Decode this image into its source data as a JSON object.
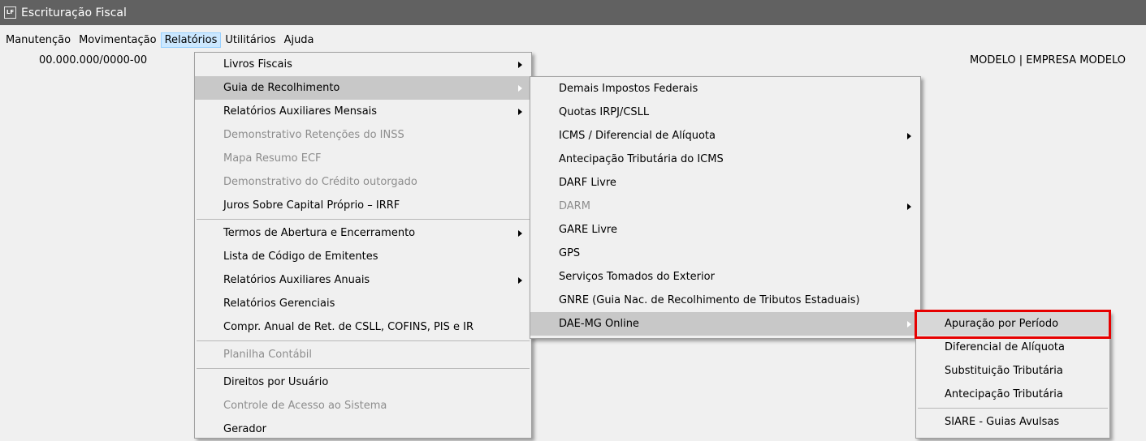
{
  "window": {
    "icon_text": "LF",
    "title": "Escrituração Fiscal"
  },
  "menubar": {
    "items": [
      "Manutenção",
      "Movimentação",
      "Relatórios",
      "Utilitários",
      "Ajuda"
    ],
    "active": "Relatórios"
  },
  "info": {
    "cnpj": "00.000.000/0000-00",
    "empresa": "MODELO | EMPRESA MODELO"
  },
  "relatorios_menu": {
    "items": [
      {
        "label": "Livros Fiscais",
        "submenu": true,
        "enabled": true
      },
      {
        "label": "Guia de Recolhimento",
        "submenu": true,
        "enabled": true,
        "highlighted": true
      },
      {
        "label": "Relatórios Auxiliares Mensais",
        "submenu": true,
        "enabled": true
      },
      {
        "label": "Demonstrativo Retenções do INSS",
        "submenu": false,
        "enabled": false
      },
      {
        "label": "Mapa Resumo ECF",
        "submenu": false,
        "enabled": false
      },
      {
        "label": "Demonstrativo do Crédito outorgado",
        "submenu": false,
        "enabled": false
      },
      {
        "label": "Juros Sobre Capital Próprio – IRRF",
        "submenu": false,
        "enabled": true
      },
      {
        "label": "Termos de Abertura e Encerramento",
        "submenu": true,
        "enabled": true
      },
      {
        "label": "Lista de Código de Emitentes",
        "submenu": false,
        "enabled": true
      },
      {
        "label": "Relatórios Auxiliares Anuais",
        "submenu": true,
        "enabled": true
      },
      {
        "label": "Relatórios Gerenciais",
        "submenu": false,
        "enabled": true
      },
      {
        "label": "Compr. Anual de Ret. de CSLL, COFINS,  PIS e IR",
        "submenu": false,
        "enabled": true
      },
      {
        "label": "Planilha Contábil",
        "submenu": false,
        "enabled": false
      },
      {
        "label": "Direitos por Usuário",
        "submenu": false,
        "enabled": true
      },
      {
        "label": "Controle de Acesso ao Sistema",
        "submenu": false,
        "enabled": false
      },
      {
        "label": "Gerador",
        "submenu": false,
        "enabled": true
      }
    ]
  },
  "guia_menu": {
    "items": [
      {
        "label": "Demais Impostos Federais",
        "submenu": false,
        "enabled": true
      },
      {
        "label": "Quotas IRPJ/CSLL",
        "submenu": false,
        "enabled": true
      },
      {
        "label": "ICMS / Diferencial de Alíquota",
        "submenu": true,
        "enabled": true
      },
      {
        "label": "Antecipação Tributária do ICMS",
        "submenu": false,
        "enabled": true
      },
      {
        "label": "DARF Livre",
        "submenu": false,
        "enabled": true
      },
      {
        "label": "DARM",
        "submenu": true,
        "enabled": false
      },
      {
        "label": "GARE Livre",
        "submenu": false,
        "enabled": true
      },
      {
        "label": "GPS",
        "submenu": false,
        "enabled": true
      },
      {
        "label": "Serviços Tomados do Exterior",
        "submenu": false,
        "enabled": true
      },
      {
        "label": "GNRE (Guia Nac. de Recolhimento de Tributos Estaduais)",
        "submenu": false,
        "enabled": true
      },
      {
        "label": "DAE-MG Online",
        "submenu": true,
        "enabled": true,
        "highlighted": true
      }
    ]
  },
  "daemg_menu": {
    "items": [
      {
        "label": "Apuração por Período",
        "enabled": true,
        "highlighted": true,
        "callout": true
      },
      {
        "label": "Diferencial de Alíquota",
        "enabled": true
      },
      {
        "label": "Substituição Tributária",
        "enabled": true
      },
      {
        "label": "Antecipação Tributária",
        "enabled": true
      },
      {
        "label": "SIARE - Guias Avulsas",
        "enabled": true
      }
    ]
  },
  "colors": {
    "titlebar": "#616161",
    "menubar_active": "#cce8ff",
    "disabled_text": "#8d8d8d",
    "callout_border": "#e60000"
  }
}
